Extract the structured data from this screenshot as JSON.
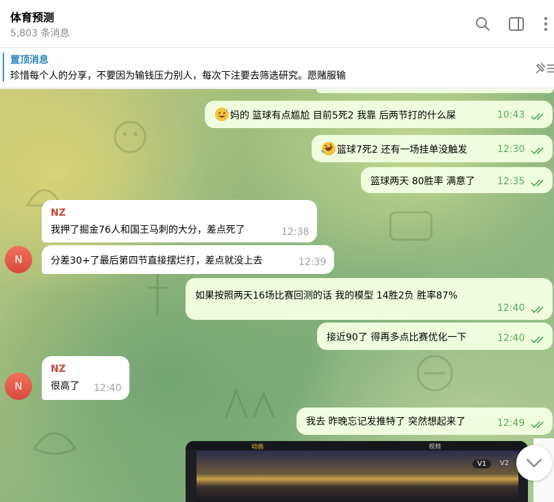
{
  "header": {
    "title": "体育预测",
    "subtitle": "5,803 条消息",
    "icons": [
      "search-icon",
      "sidebar-toggle-icon",
      "more-vertical-icon"
    ]
  },
  "pinned": {
    "title": "置顶消息",
    "text": "珍惜每个人的分享，不要因为输钱压力别人，每次下注要去筛选研究。愿赌服输",
    "icon": "pin-icon"
  },
  "messages": [
    {
      "direction": "out",
      "text": "妈的 篮球有点尴尬 目前5死2  我靠 后两节打的什么屎",
      "emoji": "sweat-smile",
      "time": "10:43"
    },
    {
      "direction": "out",
      "text": "篮球7死2  还有一场挂单没触发",
      "emoji": "rofl",
      "time": "12:30"
    },
    {
      "direction": "out",
      "text": "篮球两天 80胜率 满意了",
      "time": "12:35"
    },
    {
      "direction": "in",
      "sender": "NZ",
      "text": "我押了掘金76人和国王马刺的大分，差点死了",
      "time": "12:38"
    },
    {
      "direction": "in",
      "text": "分差30+了最后第四节直接摆烂打，差点就没上去",
      "time": "12:39",
      "avatar": "N"
    },
    {
      "direction": "out",
      "text": "如果按照两天16场比赛回测的话  我的模型 14胜2负  胜率87%",
      "time": "12:40"
    },
    {
      "direction": "out",
      "text": "接近90了  得再多点比赛优化一下",
      "time": "12:40"
    },
    {
      "direction": "in",
      "sender": "NZ",
      "text": "很高了",
      "time": "12:40",
      "avatar": "N"
    },
    {
      "direction": "out",
      "text": "我去 昨晚忘记发推特了 突然想起来了",
      "time": "12:49"
    }
  ],
  "media": {
    "tab_left": "动画",
    "tab_right": "视频",
    "v1": "V1",
    "v2": "V2"
  },
  "colors": {
    "outgoing_bubble": "#effdde",
    "incoming_bubble": "#ffffff",
    "time_out": "#5fa65a",
    "sender_name": "#c7443b",
    "pinned_title": "#2f86c2"
  }
}
